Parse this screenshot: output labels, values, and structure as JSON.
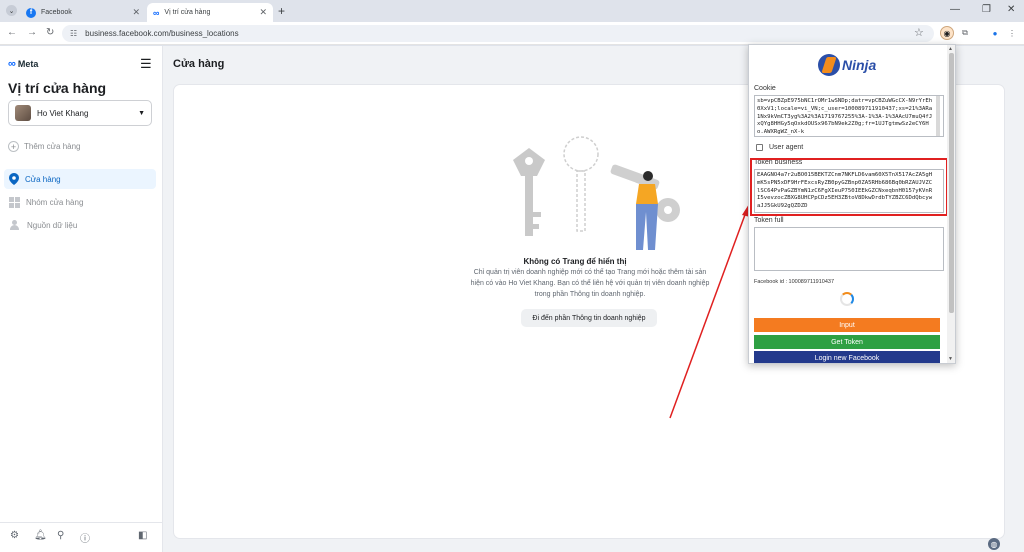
{
  "browser": {
    "tabs": [
      {
        "title": "Facebook",
        "active": false
      },
      {
        "title": "Vị trí cửa hàng",
        "active": true
      }
    ],
    "url": "business.facebook.com/business_locations"
  },
  "sidebar": {
    "brand": "Meta",
    "title": "Vị trí cửa hàng",
    "account_name": "Ho Viet Khang",
    "add_store": "Thêm cửa hàng",
    "items": [
      {
        "label": "Cửa hàng",
        "active": true
      },
      {
        "label": "Nhóm cửa hàng",
        "active": false
      },
      {
        "label": "Nguồn dữ liệu",
        "active": false
      }
    ]
  },
  "main": {
    "section_title": "Cửa hàng",
    "empty_title": "Không có Trang để hiển thị",
    "empty_body": "Chỉ quản trị viên doanh nghiệp mới có thể tạo Trang mới hoặc thêm tài sản hiện có vào Ho Viet Khang. Bạn có thể liên hệ với quản trị viên doanh nghiệp trong phần Thông tin doanh nghiệp.",
    "empty_button": "Đi đến phần Thông tin doanh nghiệp"
  },
  "extension": {
    "logo_text": "Ninja",
    "cookie_label": "Cookie",
    "cookie_value": "sb=vpCBZpE975bNC1rOMr1wSNDp;datr=vpCBZuWGcCX-N9rYrEh0XxV1;locale=vi_VN;c_user=100089711910437;xs=21%3ARa1Nx9kVmCT3yg%3A2%3A1719767255%3A-1%3A-1%3AAcU7muQ4fJxQYg8HHGy5qOxkdOUSx967bN9ek2Z0g;fr=1UJTgtmwSz2eCY6Ho.AWXRgWZ_nX-k",
    "user_agent_label": "User agent",
    "token_business_label": "Token business",
    "token_business_value": "EAAGNO4a7r2uBO015BEKTZCnm7NKFLD6vam60X5TnX517AcZA5gHmK5sPN5xDF9HrFExcsRyZB0pyGZBnp0ZA5RHb686Bq0bRZAUJVZClSC64PvPaGZBYmN1zC6FgXIeuP750IEEkGZCNxeqbnH0157yKVnRI5vevzocZBXG8UHCPpCDz5EH3ZBtoV8DkwDrdbTYZBZC6DdQbcywaJJ5GkU92gQZDZD",
    "token_full_label": "Token full",
    "token_full_value": "",
    "facebook_id": "Facebook id : 100089711910437",
    "buttons": {
      "input": "Input",
      "get_token": "Get Token",
      "login_new": "Login new Facebook"
    },
    "colors": {
      "input": "#f47b20",
      "get_token": "#2ea043",
      "login_new": "#243a8c",
      "highlight": "#e02020",
      "annotation_arrow": "#e02020"
    }
  }
}
